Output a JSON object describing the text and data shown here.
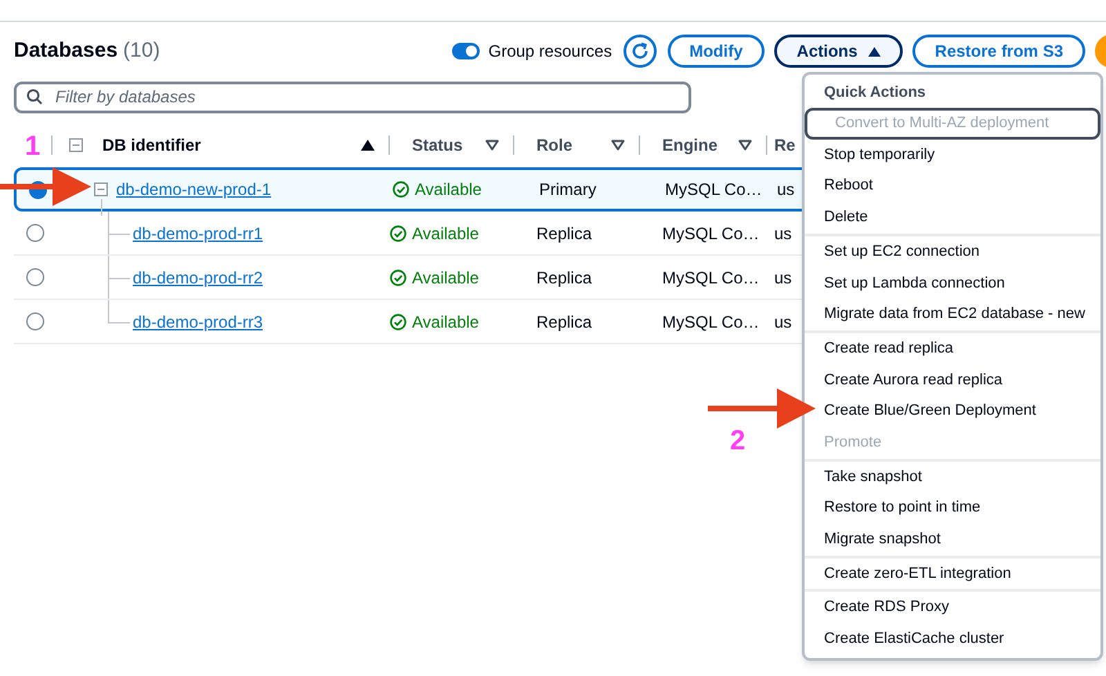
{
  "header": {
    "title": "Databases",
    "count": "(10)",
    "group_resources": {
      "label": "Group resources",
      "on": true
    },
    "buttons": [
      {
        "kind": "refresh"
      },
      {
        "kind": "button",
        "label": "Modify"
      },
      {
        "kind": "dropdown",
        "label": "Actions",
        "expanded": true
      },
      {
        "kind": "button",
        "label": "Restore from S3"
      }
    ]
  },
  "search": {
    "placeholder": "Filter by databases"
  },
  "table": {
    "columns": [
      {
        "label": "DB identifier",
        "sorted": true
      },
      {
        "label": "Status",
        "sorted": false
      },
      {
        "label": "Role",
        "sorted": false
      },
      {
        "label": "Engine",
        "sorted": false
      },
      {
        "label": "Re"
      }
    ],
    "rows": [
      {
        "id": "db-demo-new-prod-1",
        "status": "Available",
        "role": "Primary",
        "engine": "MySQL Co…",
        "column_5": "us",
        "selected": true,
        "expanded": true,
        "children": [
          {
            "id": "db-demo-prod-rr1",
            "status": "Available",
            "role": "Replica",
            "engine": "MySQL Co…",
            "column_5": "us",
            "selected": false
          },
          {
            "id": "db-demo-prod-rr2",
            "status": "Available",
            "role": "Replica",
            "engine": "MySQL Co…",
            "column_5": "us",
            "selected": false
          },
          {
            "id": "db-demo-prod-rr3",
            "status": "Available",
            "role": "Replica",
            "engine": "MySQL Co…",
            "column_5": "us",
            "selected": false
          }
        ]
      }
    ]
  },
  "actions_menu": {
    "heading": "Quick Actions",
    "groups": [
      [
        {
          "label": "Convert to Multi-AZ deployment",
          "disabled": true,
          "focused": true
        },
        {
          "label": "Stop temporarily",
          "disabled": false,
          "focused": false
        },
        {
          "label": "Reboot",
          "disabled": false,
          "focused": false
        },
        {
          "label": "Delete",
          "disabled": false,
          "focused": false
        }
      ],
      [
        {
          "label": "Set up EC2 connection",
          "disabled": false,
          "focused": false
        },
        {
          "label": "Set up Lambda connection",
          "disabled": false,
          "focused": false
        },
        {
          "label": "Migrate data from EC2 database - new",
          "disabled": false,
          "focused": false
        }
      ],
      [
        {
          "label": "Create read replica",
          "disabled": false,
          "focused": false
        },
        {
          "label": "Create Aurora read replica",
          "disabled": false,
          "focused": false
        },
        {
          "label": "Create Blue/Green Deployment",
          "disabled": false,
          "focused": false
        },
        {
          "label": "Promote",
          "disabled": true,
          "focused": false
        }
      ],
      [
        {
          "label": "Take snapshot",
          "disabled": false,
          "focused": false
        },
        {
          "label": "Restore to point in time",
          "disabled": false,
          "focused": false
        },
        {
          "label": "Migrate snapshot",
          "disabled": false,
          "focused": false
        }
      ],
      [
        {
          "label": "Create zero-ETL integration",
          "disabled": false,
          "focused": false
        }
      ],
      [
        {
          "label": "Create RDS Proxy",
          "disabled": false,
          "focused": false
        },
        {
          "label": "Create ElastiCache cluster",
          "disabled": false,
          "focused": false
        }
      ]
    ]
  },
  "annotations": [
    {
      "label": "1"
    },
    {
      "label": "2"
    }
  ]
}
